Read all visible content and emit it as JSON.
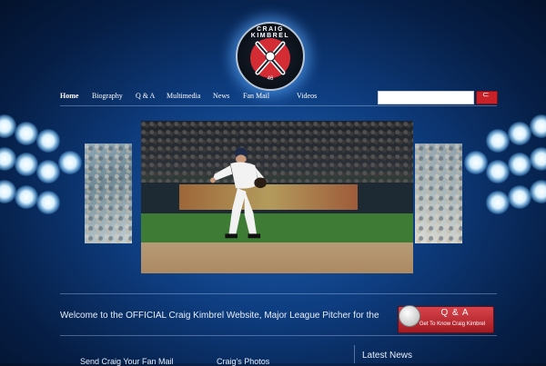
{
  "logo": {
    "text": "CRAIG KIMBREL",
    "number": "46"
  },
  "nav": {
    "items": [
      {
        "label": "Home",
        "active": true
      },
      {
        "label": "Biography",
        "active": false
      },
      {
        "label": "Q & A",
        "active": false
      },
      {
        "label": "Multimedia",
        "active": false
      },
      {
        "label": "News",
        "active": false
      },
      {
        "label": "Fan Mail",
        "active": false
      },
      {
        "label": "Videos",
        "active": false
      }
    ]
  },
  "search": {
    "placeholder": "",
    "button_label": "⊂"
  },
  "welcome": {
    "text": "Welcome to the OFFICIAL Craig Kimbrel Website, Major League Pitcher for the"
  },
  "qa_button": {
    "title": "Q & A",
    "subtitle": "Get To Know Craig Kimbrel"
  },
  "footer": {
    "fan_mail": "Send Craig Your Fan Mail",
    "photos": "Craig's Photos",
    "latest_news": "Latest News"
  },
  "colors": {
    "accent": "#c92128",
    "background": "#0e3d80"
  }
}
